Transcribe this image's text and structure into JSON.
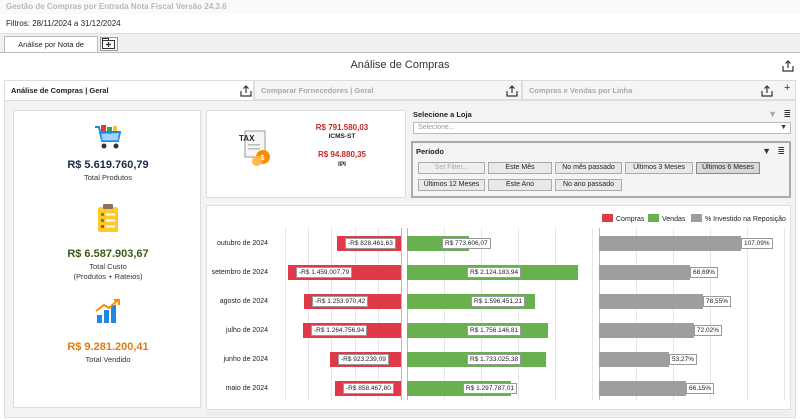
{
  "window": {
    "title": "Gestão de Compras por Entrada Nota Fiscal Versão 24.3.6"
  },
  "filters": {
    "text": "Filtros: 28/11/2024 a 31/12/2024"
  },
  "tabs": [
    {
      "label": "Análise por Nota de Entrada"
    }
  ],
  "page": {
    "title": "Análise de Compras"
  },
  "subtabs": [
    {
      "label": "Análise de Compras | Geral"
    },
    {
      "label": "Comparar Fornecedores | Geral"
    },
    {
      "label": "Compras e Vendas por Linha"
    }
  ],
  "kpis": {
    "total_produtos": {
      "value": "R$ 5.619.760,79",
      "label": "Total Produtos",
      "color": "#1c2a4a"
    },
    "total_custo": {
      "value": "R$ 6.587.903,67",
      "label": "Total Custo",
      "sublabel": "(Produtos + Rateios)",
      "color": "#3f5a16"
    },
    "total_vendido": {
      "value": "R$ 9.281.200,41",
      "label": "Total Vendido",
      "color": "#e07b12"
    }
  },
  "tax": {
    "icon_text": "TAX",
    "icms_st": {
      "value": "R$ 791.580,03",
      "label": "ICMS-ST"
    },
    "ipi": {
      "value": "R$ 94.880,35",
      "label": "IPI"
    }
  },
  "store": {
    "label": "Selecione a Loja",
    "placeholder": "Selecione..."
  },
  "period": {
    "label": "Período",
    "buttons": [
      {
        "label": "Set Filter...",
        "state": "disabled"
      },
      {
        "label": "Este Mês",
        "state": "normal"
      },
      {
        "label": "No mês passado",
        "state": "normal"
      },
      {
        "label": "Últimos 3 Meses",
        "state": "normal"
      },
      {
        "label": "Últimos 6 Meses",
        "state": "active"
      },
      {
        "label": "Últimos 12 Meses",
        "state": "normal"
      },
      {
        "label": "Este Ano",
        "state": "normal"
      },
      {
        "label": "No ano passado",
        "state": "normal"
      }
    ]
  },
  "chart_data": {
    "type": "bar",
    "orientation": "horizontal",
    "legend_position": "top-right",
    "grid": true,
    "categories": [
      "outubro de 2024",
      "setembro de 2024",
      "agosto de 2024",
      "julho de 2024",
      "junho de 2024",
      "maio de 2024"
    ],
    "series": [
      {
        "name": "Compras",
        "color": "#e03a4a",
        "values": [
          -828461.63,
          -1459007.79,
          -1253970.42,
          -1264756.94,
          -923239.09,
          -858467.8
        ],
        "labels": [
          "-R$ 828.461,63",
          "-R$ 1.459.007,79",
          "-R$ 1.253.970,42",
          "-R$ 1.264.756,94",
          "-R$ 923.239,09",
          "-R$ 858.467,80"
        ],
        "xlim": [
          -1500000,
          0
        ]
      },
      {
        "name": "Vendas",
        "color": "#69b04f",
        "values": [
          773606.07,
          2124183.94,
          1596451.21,
          1756146.81,
          1733025.38,
          1297787.01
        ],
        "labels": [
          "R$ 773.606,07",
          "R$ 2.124.183,94",
          "R$ 1.596.451,21",
          "R$ 1.756.146,81",
          "R$ 1.733.025,38",
          "R$ 1.297.787,01"
        ],
        "xlim": [
          0,
          2300000
        ]
      },
      {
        "name": "% Investido na Reposição",
        "color": "#9e9e9e",
        "values": [
          107.09,
          68.69,
          78.55,
          72.02,
          53.27,
          66.15
        ],
        "labels": [
          "107,09%",
          "68,69%",
          "78,55%",
          "72,02%",
          "53,27%",
          "66,15%"
        ],
        "xlim": [
          0,
          140
        ]
      }
    ]
  }
}
